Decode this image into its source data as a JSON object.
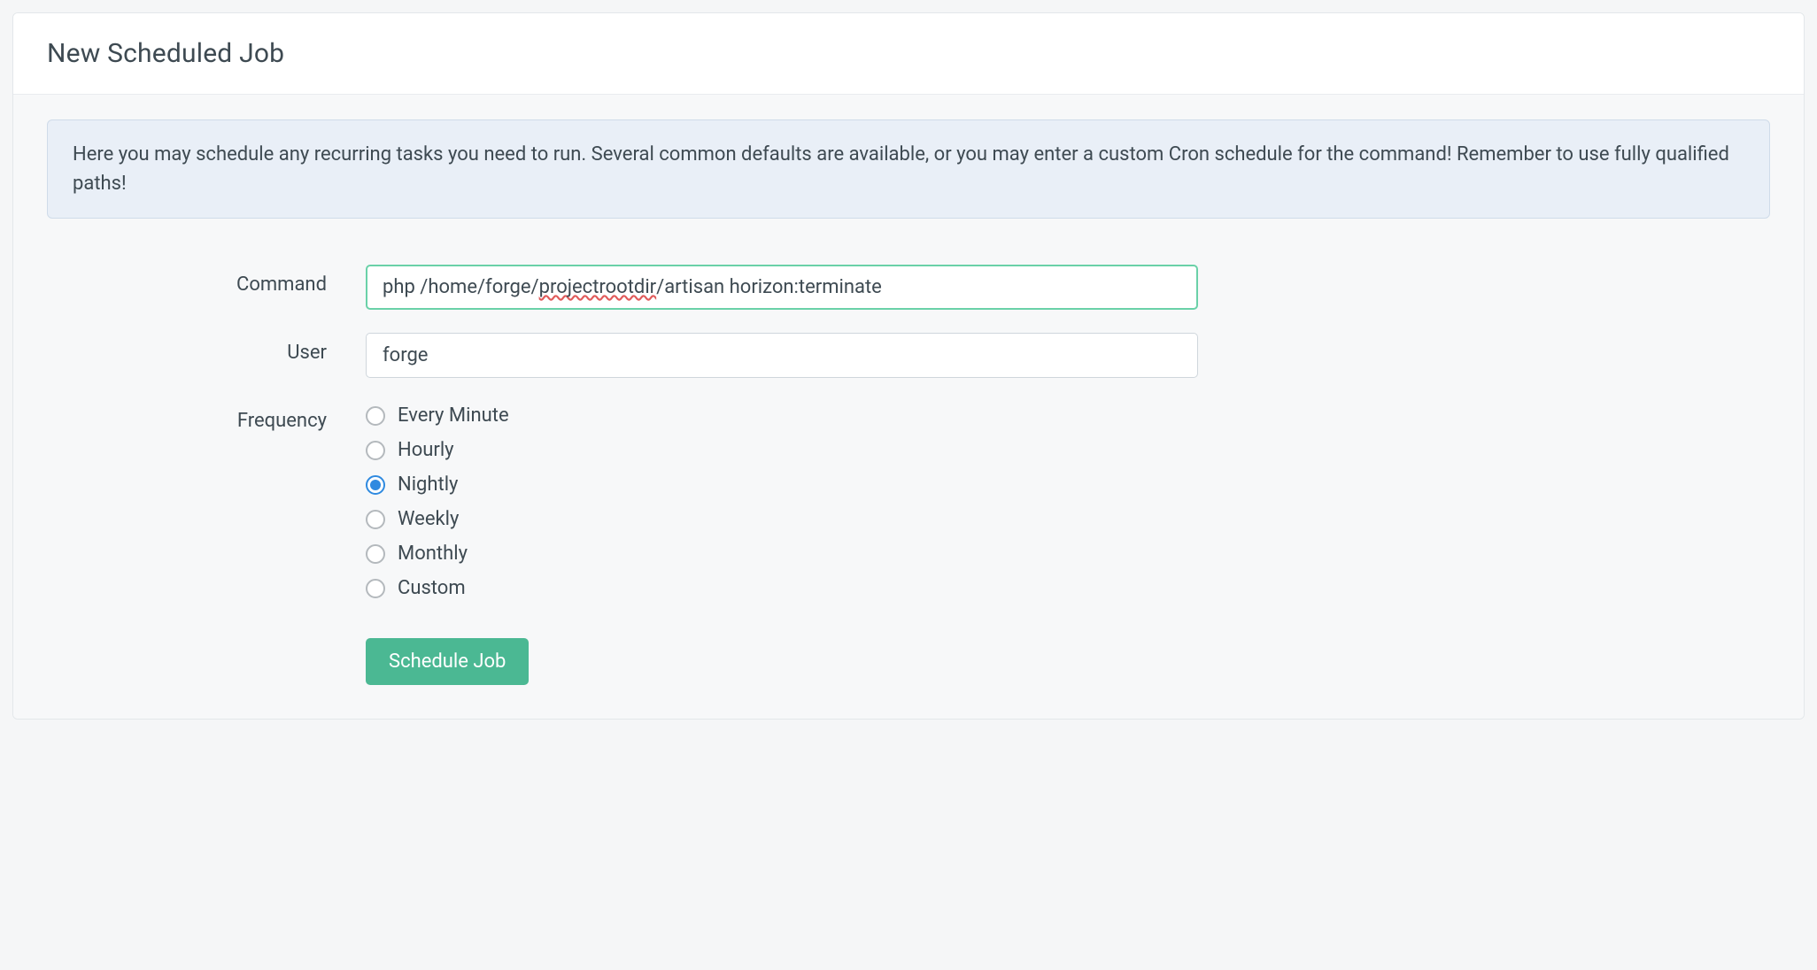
{
  "panel": {
    "title": "New Scheduled Job"
  },
  "info": {
    "text": "Here you may schedule any recurring tasks you need to run. Several common defaults are available, or you may enter a custom Cron schedule for the command! Remember to use fully qualified paths!"
  },
  "form": {
    "command": {
      "label": "Command",
      "value_pre": "php /home/forge/",
      "value_spell": "projectrootdir",
      "value_post": "/artisan horizon:terminate"
    },
    "user": {
      "label": "User",
      "value": "forge"
    },
    "frequency": {
      "label": "Frequency",
      "options": [
        {
          "label": "Every Minute",
          "checked": false
        },
        {
          "label": "Hourly",
          "checked": false
        },
        {
          "label": "Nightly",
          "checked": true
        },
        {
          "label": "Weekly",
          "checked": false
        },
        {
          "label": "Monthly",
          "checked": false
        },
        {
          "label": "Custom",
          "checked": false
        }
      ]
    },
    "submit": {
      "label": "Schedule Job"
    }
  }
}
